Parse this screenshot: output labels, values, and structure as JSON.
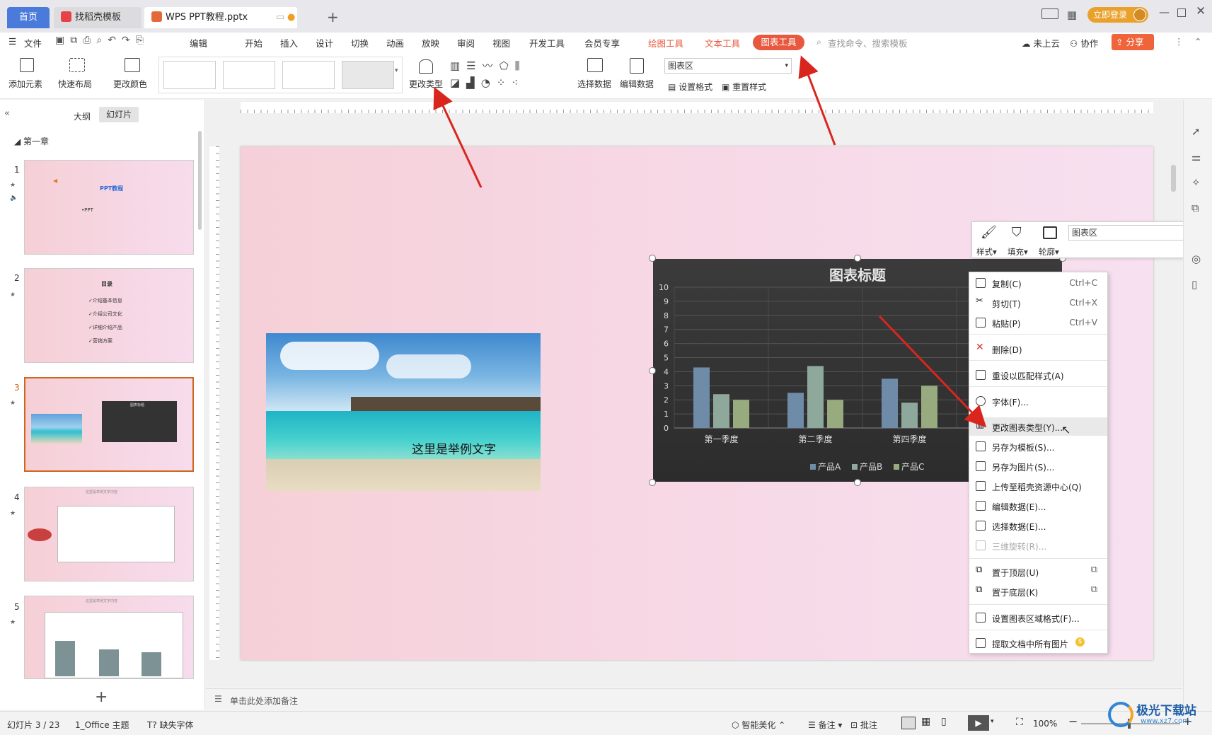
{
  "titlebar": {
    "tabs": [
      {
        "label": "首页"
      },
      {
        "label": "找稻壳模板"
      },
      {
        "label": "WPS PPT教程.pptx"
      }
    ],
    "login_label": "立即登录"
  },
  "menubar": {
    "file_label": "文件",
    "edit_label": "编辑",
    "items": [
      "开始",
      "插入",
      "设计",
      "切换",
      "动画",
      "放映",
      "审阅",
      "视图",
      "开发工具",
      "会员专享"
    ],
    "context_tabs": [
      "绘图工具",
      "文本工具",
      "图表工具"
    ],
    "search_placeholder": "查找命令、搜索模板",
    "cloud_label": "未上云",
    "collab_label": "协作",
    "share_label": "分享"
  },
  "ribbon": {
    "add_element": "添加元素",
    "quick_layout": "快速布局",
    "change_color": "更改颜色",
    "change_type": "更改类型",
    "select_data": "选择数据",
    "edit_data": "编辑数据",
    "element_combo": "图表区",
    "set_format": "设置格式",
    "reset_style": "重置样式"
  },
  "leftpanel": {
    "tab_outline": "大纲",
    "tab_slides": "幻灯片",
    "section": "第一章",
    "slides": [
      {
        "num": "1",
        "title": "PPT教程",
        "sub": "•PPT"
      },
      {
        "num": "2",
        "title": "目录",
        "lines": [
          "✓介绍基本信息",
          "✓介绍公司文化",
          "✓详细介绍产品",
          "✓营销方案"
        ]
      },
      {
        "num": "3",
        "title": "图表标题"
      },
      {
        "num": "4",
        "title": "这里是举例文字内容"
      },
      {
        "num": "5",
        "title": "这里是举例文字内容"
      }
    ]
  },
  "slide": {
    "caption": "这里是举例文字",
    "chart_data": {
      "type": "bar",
      "title": "图表标题",
      "categories": [
        "第一季度",
        "第二季度",
        "第四季度"
      ],
      "series": [
        {
          "name": "产品A",
          "values": [
            4.3,
            2.5,
            3.5
          ],
          "color": "#6e8ba8"
        },
        {
          "name": "产品B",
          "values": [
            2.4,
            4.4,
            1.8
          ],
          "color": "#8fa89c"
        },
        {
          "name": "产品C",
          "values": [
            2.0,
            2.0,
            3.0
          ],
          "color": "#98ab7e"
        }
      ],
      "ylim": [
        0,
        10
      ],
      "yticks": [
        "0",
        "1",
        "2",
        "3",
        "4",
        "5",
        "6",
        "7",
        "8",
        "9",
        "10"
      ],
      "grid": true,
      "legend": "bottom"
    }
  },
  "minitoolbar": {
    "style": "样式",
    "fill": "填充",
    "outline": "轮廓",
    "combo": "图表区"
  },
  "contextmenu": {
    "items": [
      {
        "label": "复制(C)",
        "shortcut": "Ctrl+C"
      },
      {
        "label": "剪切(T)",
        "shortcut": "Ctrl+X"
      },
      {
        "label": "粘贴(P)",
        "shortcut": "Ctrl+V"
      },
      {
        "label": "删除(D)"
      },
      {
        "label": "重设以匹配样式(A)"
      },
      {
        "label": "字体(F)..."
      },
      {
        "label": "更改图表类型(Y)..."
      },
      {
        "label": "另存为模板(S)..."
      },
      {
        "label": "另存为图片(S)..."
      },
      {
        "label": "上传至稻壳资源中心(Q)"
      },
      {
        "label": "编辑数据(E)..."
      },
      {
        "label": "选择数据(E)..."
      },
      {
        "label": "三维旋转(R)..."
      },
      {
        "label": "置于顶层(U)"
      },
      {
        "label": "置于底层(K)"
      },
      {
        "label": "设置图表区域格式(F)..."
      },
      {
        "label": "提取文档中所有图片"
      }
    ]
  },
  "notes_placeholder": "单击此处添加备注",
  "statusbar": {
    "slide_pos": "幻灯片 3 / 23",
    "theme": "1_Office 主题",
    "missing_font": "缺失字体",
    "beautify": "智能美化",
    "notes": "备注",
    "comments": "批注",
    "zoom": "100%"
  },
  "watermark": "极光下载站",
  "watermark_url": "www.xz7.com"
}
